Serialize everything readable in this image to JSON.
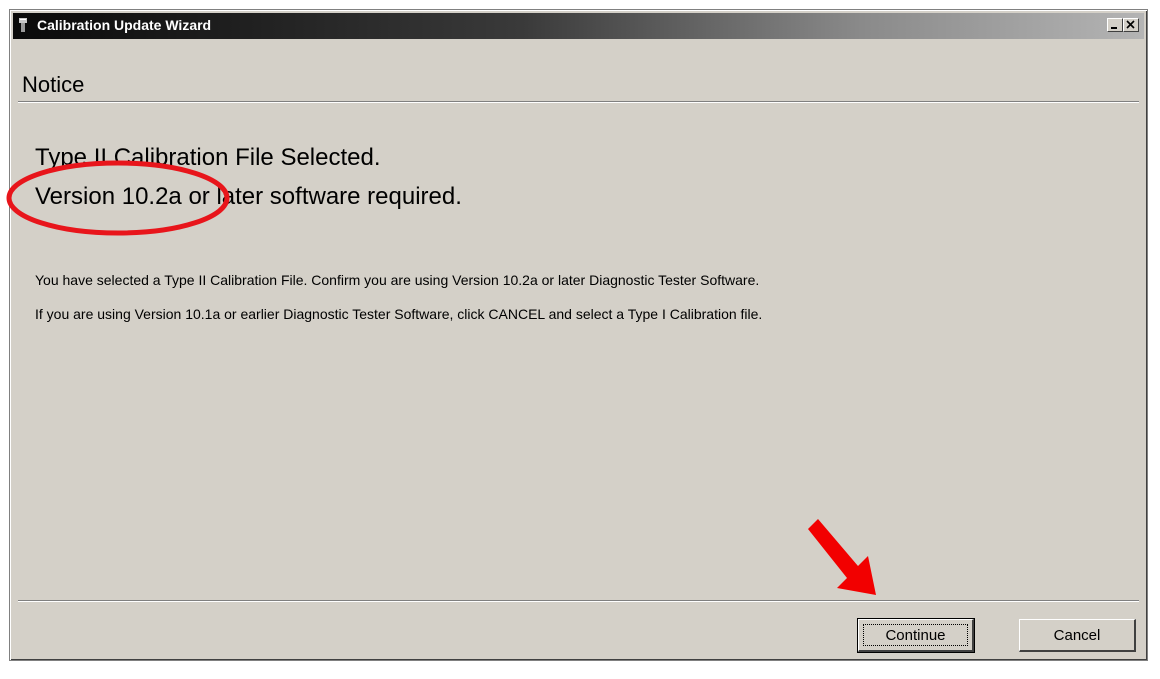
{
  "window": {
    "title": "Calibration Update Wizard"
  },
  "notice": {
    "heading": "Notice"
  },
  "message": {
    "headline_1": "Type II Calibration File Selected.",
    "headline_2": "Version 10.2a or later software required.",
    "body_1": "You have selected a Type II Calibration File.  Confirm you are using Version 10.2a or later Diagnostic Tester Software.",
    "body_2": "If you are using Version 10.1a or earlier Diagnostic Tester Software, click CANCEL and select a Type I Calibration file."
  },
  "buttons": {
    "continue_label": "Continue",
    "cancel_label": "Cancel"
  },
  "annotations": {
    "circle_color": "#e8151b",
    "arrow_color": "#f20000"
  },
  "icons": [
    "app-icon",
    "minimize-icon",
    "maximize-icon",
    "close-icon",
    "highlight-circle",
    "pointer-arrow"
  ]
}
